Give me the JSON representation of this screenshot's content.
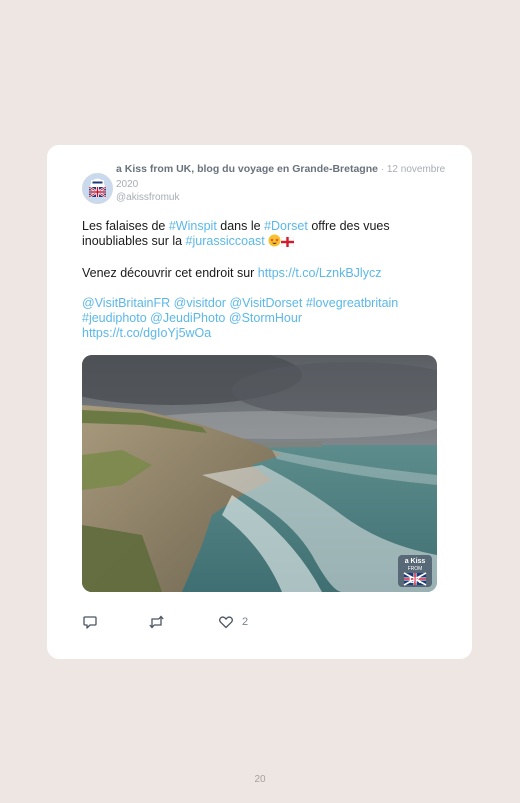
{
  "tweet": {
    "author_name": "a Kiss from UK, blog du voyage en Grande-Bretagne",
    "separator": " · ",
    "date": "12 novembre 2020",
    "handle": "@akissfromuk",
    "avatar_alt": "a Kiss from UK logo",
    "body": {
      "p1_text_1": "Les falaises de ",
      "p1_tag_winspit": "#Winspit",
      "p1_text_2": " dans le ",
      "p1_tag_dorset": "#Dorset",
      "p1_text_3": " offre des vues inoubliables sur la ",
      "p1_tag_jurassic": "#jurassiccoast",
      "p2_text": "Venez découvrir cet endroit sur ",
      "p2_link": "https://t.co/LznkBJlycz",
      "p3_mentions": [
        "@VisitBritainFR",
        "@visitdor",
        "@VisitDorset",
        "#lovegreatbritain",
        "#jeudiphoto",
        "@JeudiPhoto",
        "@StormHour",
        "https://t.co/dgIoYj5wOa"
      ]
    },
    "photo": {
      "description": "Winspit cliffs, Dorset coast",
      "watermark_line1": "a Kiss",
      "watermark_line2": "FROM",
      "watermark_line3": "UK"
    },
    "actions": {
      "reply_icon": "reply-icon",
      "retweet_icon": "retweet-icon",
      "like_icon": "heart-icon",
      "like_count": "2"
    }
  },
  "page": {
    "number": "20"
  },
  "colors": {
    "background": "#ede6e2",
    "card": "#ffffff",
    "link": "#5bb8e9",
    "muted": "#a6adb4"
  }
}
